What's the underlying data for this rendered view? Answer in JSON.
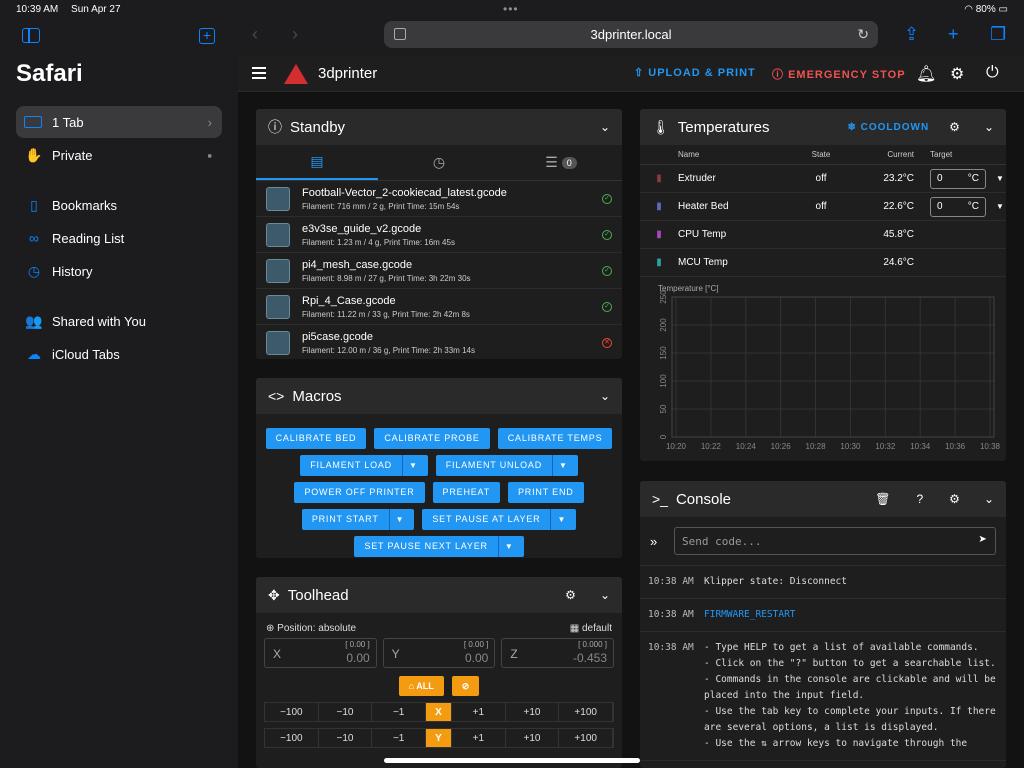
{
  "status": {
    "time": "10:39 AM",
    "date": "Sun Apr 27",
    "battery": "80%"
  },
  "sidebar": {
    "title": "Safari",
    "items": [
      {
        "label": "1 Tab",
        "right": "›"
      },
      {
        "label": "Private",
        "right": "🔒"
      },
      {
        "label": "Bookmarks"
      },
      {
        "label": "Reading List"
      },
      {
        "label": "History"
      },
      {
        "label": "Shared with You"
      },
      {
        "label": "iCloud Tabs"
      }
    ]
  },
  "browser": {
    "url": "3dprinter.local"
  },
  "appbar": {
    "title": "3dprinter",
    "upload_label": "UPLOAD & PRINT",
    "estop_label": "EMERGENCY STOP"
  },
  "standby": {
    "title": "Standby",
    "queue_count": "0",
    "files": [
      {
        "name": "Football-Vector_2-cookiecad_latest.gcode",
        "meta": "Filament: 716 mm / 2 g, Print Time: 15m 54s",
        "ok": true
      },
      {
        "name": "e3v3se_guide_v2.gcode",
        "meta": "Filament: 1.23 m / 4 g, Print Time: 16m 45s",
        "ok": true
      },
      {
        "name": "pi4_mesh_case.gcode",
        "meta": "Filament: 8.98 m / 27 g, Print Time: 3h 22m 30s",
        "ok": true
      },
      {
        "name": "Rpi_4_Case.gcode",
        "meta": "Filament: 11.22 m / 33 g, Print Time: 2h 42m 8s",
        "ok": true
      },
      {
        "name": "pi5case.gcode",
        "meta": "Filament: 12.00 m / 36 g, Print Time: 2h 33m 14s",
        "ok": false
      }
    ]
  },
  "macros": {
    "title": "Macros",
    "rows": [
      [
        {
          "label": "CALIBRATE BED"
        },
        {
          "label": "CALIBRATE PROBE"
        },
        {
          "label": "CALIBRATE TEMPS"
        }
      ],
      [
        {
          "label": "FILAMENT LOAD",
          "dd": true
        },
        {
          "label": "FILAMENT UNLOAD",
          "dd": true
        }
      ],
      [
        {
          "label": "POWER OFF PRINTER"
        },
        {
          "label": "PREHEAT"
        },
        {
          "label": "PRINT END"
        }
      ],
      [
        {
          "label": "PRINT START",
          "dd": true
        },
        {
          "label": "SET PAUSE AT LAYER",
          "dd": true
        }
      ],
      [
        {
          "label": "SET PAUSE NEXT LAYER",
          "dd": true
        }
      ]
    ]
  },
  "toolhead": {
    "title": "Toolhead",
    "position_label": "Position: absolute",
    "preset_label": "default",
    "axes": [
      {
        "label": "X",
        "top": "[ 0.00 ]",
        "value": "0.00"
      },
      {
        "label": "Y",
        "top": "[ 0.00 ]",
        "value": "0.00"
      },
      {
        "label": "Z",
        "top": "[ 0.000 ]",
        "value": "-0.453"
      }
    ],
    "home_all_label": "ALL",
    "jog_x": [
      "−100",
      "−10",
      "−1",
      "X",
      "+1",
      "+10",
      "+100"
    ],
    "jog_y": [
      "−100",
      "−10",
      "−1",
      "Y",
      "+1",
      "+10",
      "+100"
    ]
  },
  "temps": {
    "title": "Temperatures",
    "cooldown_label": "COOLDOWN",
    "headers": {
      "name": "Name",
      "state": "State",
      "current": "Current",
      "target": "Target"
    },
    "rows": [
      {
        "name": "Extruder",
        "state": "off",
        "current": "23.2°C",
        "target": "0",
        "unit": "°C",
        "icon_color": "#8b3a3a"
      },
      {
        "name": "Heater Bed",
        "state": "off",
        "current": "22.6°C",
        "target": "0",
        "unit": "°C",
        "icon_color": "#5c6bc0"
      },
      {
        "name": "CPU Temp",
        "state": "",
        "current": "45.8°C",
        "icon_color": "#ab47bc"
      },
      {
        "name": "MCU Temp",
        "state": "",
        "current": "24.6°C",
        "icon_color": "#26a69a"
      }
    ]
  },
  "chart_data": {
    "type": "line",
    "ylabel": "Temperature [°C]",
    "ylim": [
      0,
      250
    ],
    "yticks": [
      "0",
      "50",
      "100",
      "150",
      "200",
      "250"
    ],
    "xticks": [
      "10:20",
      "10:22",
      "10:24",
      "10:26",
      "10:28",
      "10:30",
      "10:32",
      "10:34",
      "10:36",
      "10:38"
    ],
    "grid": true,
    "series": []
  },
  "console": {
    "title": "Console",
    "placeholder": "Send code...",
    "logs": [
      {
        "time": "10:38 AM",
        "text": "Klipper state: Disconnect"
      },
      {
        "time": "10:38 AM",
        "cmd": "FIRMWARE_RESTART"
      },
      {
        "time": "10:38 AM",
        "lines": [
          "- Type HELP to get a list of available commands.",
          "- Click on the \"?\" button to get a searchable list.",
          "- Commands in the console are clickable and will be placed into the input field.",
          "- Use the tab key to complete your inputs. If there are several options, a list is displayed.",
          "- Use the ⇅ arrow keys to navigate through the"
        ]
      }
    ]
  }
}
